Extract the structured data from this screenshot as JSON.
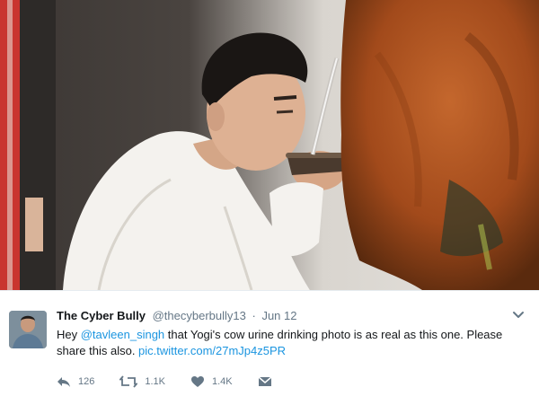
{
  "tweet": {
    "author_name": "The Cyber Bully",
    "author_handle": "@thecyberbully13",
    "separator": "·",
    "date": "Jun 12",
    "text_prefix": "Hey ",
    "mention": "@tavleen_singh",
    "text_middle": " that Yogi's cow urine drinking photo is as real as this one. Please share this also. ",
    "pic_link": "pic.twitter.com/27mJp4z5PR",
    "reply_count": "126",
    "retweet_count": "1.1K",
    "like_count": "1.4K"
  },
  "colors": {
    "link": "#1b95e0",
    "secondary_text": "#657786",
    "primary_text": "#14171a"
  },
  "icons": [
    "reply-icon",
    "retweet-icon",
    "like-icon",
    "message-icon",
    "chevron-down-icon"
  ]
}
